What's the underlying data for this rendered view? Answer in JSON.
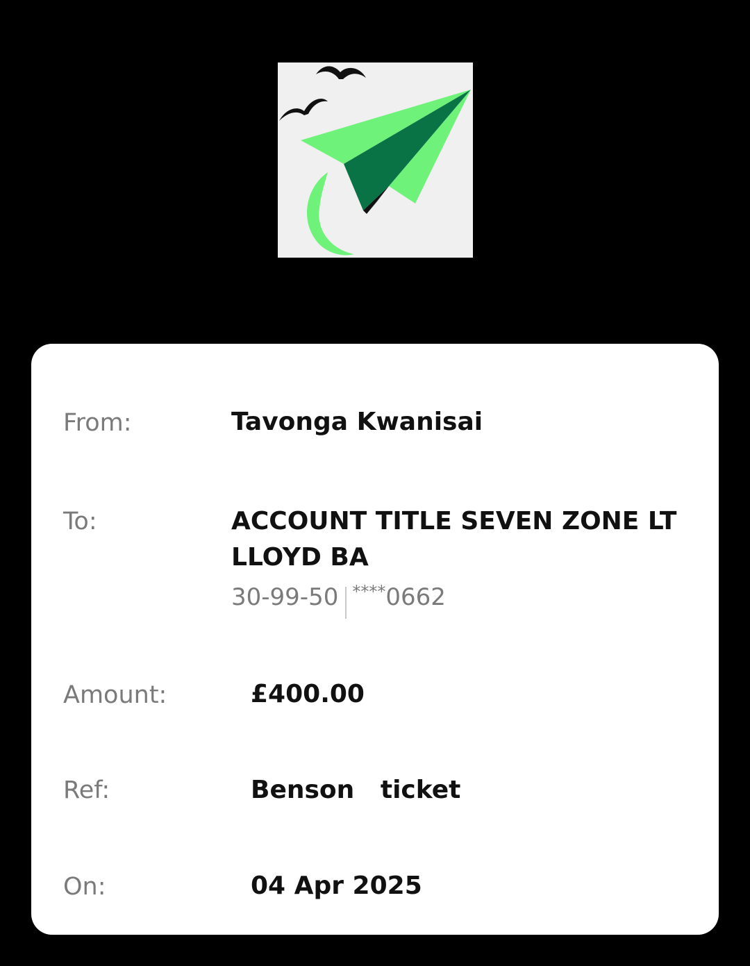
{
  "logo": {
    "icon": "paper-plane-icon",
    "colors": {
      "background": "#f0f0f0",
      "plane_light": "#6ef27a",
      "plane_dark": "#0a7345"
    }
  },
  "receipt": {
    "from": {
      "label": "From:",
      "value": "Tavonga Kwanisai"
    },
    "to": {
      "label": "To:",
      "name_line1": "ACCOUNT TITLE SEVEN ZONE LT",
      "name_line2": "LLOYD BA",
      "sort_code": "30-99-50",
      "account_mask": "****",
      "account_last4": "0662"
    },
    "amount": {
      "label": "Amount:",
      "value": "£400.00"
    },
    "ref": {
      "label": "Ref:",
      "value": "Benson   ticket"
    },
    "on": {
      "label": "On:",
      "value": "04 Apr 2025"
    }
  }
}
